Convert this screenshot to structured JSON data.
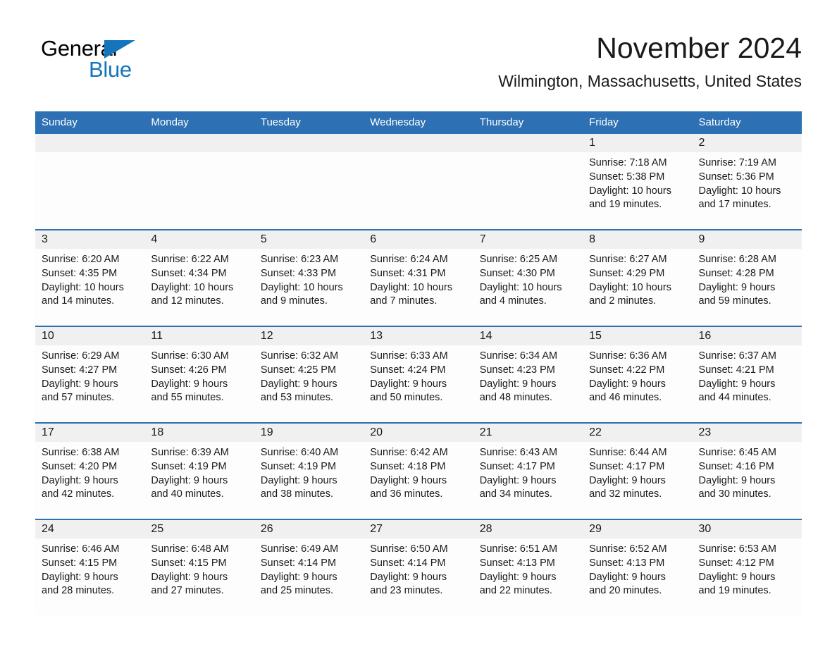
{
  "brand": {
    "line1": "General",
    "line2": "Blue",
    "triangle_icon": "general-blue-triangle",
    "line1_color": "#000000",
    "line2_color": "#1574bb"
  },
  "header": {
    "month_title": "November 2024",
    "location": "Wilmington, Massachusetts, United States"
  },
  "theme": {
    "header_blue": "#2d70b3",
    "row_divider_blue": "#2d70b3",
    "daynum_band": "#f0f0f0",
    "cell_background": "#fdfdfd",
    "text": "#1a1a1a"
  },
  "calendar": {
    "weekday_headers": [
      "Sunday",
      "Monday",
      "Tuesday",
      "Wednesday",
      "Thursday",
      "Friday",
      "Saturday"
    ],
    "weeks": [
      [
        {
          "day": "",
          "lines": []
        },
        {
          "day": "",
          "lines": []
        },
        {
          "day": "",
          "lines": []
        },
        {
          "day": "",
          "lines": []
        },
        {
          "day": "",
          "lines": []
        },
        {
          "day": "1",
          "lines": [
            "Sunrise: 7:18 AM",
            "Sunset: 5:38 PM",
            "Daylight: 10 hours",
            "and 19 minutes."
          ]
        },
        {
          "day": "2",
          "lines": [
            "Sunrise: 7:19 AM",
            "Sunset: 5:36 PM",
            "Daylight: 10 hours",
            "and 17 minutes."
          ]
        }
      ],
      [
        {
          "day": "3",
          "lines": [
            "Sunrise: 6:20 AM",
            "Sunset: 4:35 PM",
            "Daylight: 10 hours",
            "and 14 minutes."
          ]
        },
        {
          "day": "4",
          "lines": [
            "Sunrise: 6:22 AM",
            "Sunset: 4:34 PM",
            "Daylight: 10 hours",
            "and 12 minutes."
          ]
        },
        {
          "day": "5",
          "lines": [
            "Sunrise: 6:23 AM",
            "Sunset: 4:33 PM",
            "Daylight: 10 hours",
            "and 9 minutes."
          ]
        },
        {
          "day": "6",
          "lines": [
            "Sunrise: 6:24 AM",
            "Sunset: 4:31 PM",
            "Daylight: 10 hours",
            "and 7 minutes."
          ]
        },
        {
          "day": "7",
          "lines": [
            "Sunrise: 6:25 AM",
            "Sunset: 4:30 PM",
            "Daylight: 10 hours",
            "and 4 minutes."
          ]
        },
        {
          "day": "8",
          "lines": [
            "Sunrise: 6:27 AM",
            "Sunset: 4:29 PM",
            "Daylight: 10 hours",
            "and 2 minutes."
          ]
        },
        {
          "day": "9",
          "lines": [
            "Sunrise: 6:28 AM",
            "Sunset: 4:28 PM",
            "Daylight: 9 hours",
            "and 59 minutes."
          ]
        }
      ],
      [
        {
          "day": "10",
          "lines": [
            "Sunrise: 6:29 AM",
            "Sunset: 4:27 PM",
            "Daylight: 9 hours",
            "and 57 minutes."
          ]
        },
        {
          "day": "11",
          "lines": [
            "Sunrise: 6:30 AM",
            "Sunset: 4:26 PM",
            "Daylight: 9 hours",
            "and 55 minutes."
          ]
        },
        {
          "day": "12",
          "lines": [
            "Sunrise: 6:32 AM",
            "Sunset: 4:25 PM",
            "Daylight: 9 hours",
            "and 53 minutes."
          ]
        },
        {
          "day": "13",
          "lines": [
            "Sunrise: 6:33 AM",
            "Sunset: 4:24 PM",
            "Daylight: 9 hours",
            "and 50 minutes."
          ]
        },
        {
          "day": "14",
          "lines": [
            "Sunrise: 6:34 AM",
            "Sunset: 4:23 PM",
            "Daylight: 9 hours",
            "and 48 minutes."
          ]
        },
        {
          "day": "15",
          "lines": [
            "Sunrise: 6:36 AM",
            "Sunset: 4:22 PM",
            "Daylight: 9 hours",
            "and 46 minutes."
          ]
        },
        {
          "day": "16",
          "lines": [
            "Sunrise: 6:37 AM",
            "Sunset: 4:21 PM",
            "Daylight: 9 hours",
            "and 44 minutes."
          ]
        }
      ],
      [
        {
          "day": "17",
          "lines": [
            "Sunrise: 6:38 AM",
            "Sunset: 4:20 PM",
            "Daylight: 9 hours",
            "and 42 minutes."
          ]
        },
        {
          "day": "18",
          "lines": [
            "Sunrise: 6:39 AM",
            "Sunset: 4:19 PM",
            "Daylight: 9 hours",
            "and 40 minutes."
          ]
        },
        {
          "day": "19",
          "lines": [
            "Sunrise: 6:40 AM",
            "Sunset: 4:19 PM",
            "Daylight: 9 hours",
            "and 38 minutes."
          ]
        },
        {
          "day": "20",
          "lines": [
            "Sunrise: 6:42 AM",
            "Sunset: 4:18 PM",
            "Daylight: 9 hours",
            "and 36 minutes."
          ]
        },
        {
          "day": "21",
          "lines": [
            "Sunrise: 6:43 AM",
            "Sunset: 4:17 PM",
            "Daylight: 9 hours",
            "and 34 minutes."
          ]
        },
        {
          "day": "22",
          "lines": [
            "Sunrise: 6:44 AM",
            "Sunset: 4:17 PM",
            "Daylight: 9 hours",
            "and 32 minutes."
          ]
        },
        {
          "day": "23",
          "lines": [
            "Sunrise: 6:45 AM",
            "Sunset: 4:16 PM",
            "Daylight: 9 hours",
            "and 30 minutes."
          ]
        }
      ],
      [
        {
          "day": "24",
          "lines": [
            "Sunrise: 6:46 AM",
            "Sunset: 4:15 PM",
            "Daylight: 9 hours",
            "and 28 minutes."
          ]
        },
        {
          "day": "25",
          "lines": [
            "Sunrise: 6:48 AM",
            "Sunset: 4:15 PM",
            "Daylight: 9 hours",
            "and 27 minutes."
          ]
        },
        {
          "day": "26",
          "lines": [
            "Sunrise: 6:49 AM",
            "Sunset: 4:14 PM",
            "Daylight: 9 hours",
            "and 25 minutes."
          ]
        },
        {
          "day": "27",
          "lines": [
            "Sunrise: 6:50 AM",
            "Sunset: 4:14 PM",
            "Daylight: 9 hours",
            "and 23 minutes."
          ]
        },
        {
          "day": "28",
          "lines": [
            "Sunrise: 6:51 AM",
            "Sunset: 4:13 PM",
            "Daylight: 9 hours",
            "and 22 minutes."
          ]
        },
        {
          "day": "29",
          "lines": [
            "Sunrise: 6:52 AM",
            "Sunset: 4:13 PM",
            "Daylight: 9 hours",
            "and 20 minutes."
          ]
        },
        {
          "day": "30",
          "lines": [
            "Sunrise: 6:53 AM",
            "Sunset: 4:12 PM",
            "Daylight: 9 hours",
            "and 19 minutes."
          ]
        }
      ]
    ]
  }
}
